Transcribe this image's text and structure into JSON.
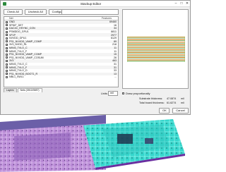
{
  "window": {
    "title": "Stackup Editor"
  },
  "toolbar": {
    "check_all": "Check All",
    "uncheck_all": "Uncheck All",
    "configure_nets": "Configure Nets"
  },
  "search": {
    "value": ""
  },
  "table": {
    "headers": [
      "Net",
      "Features"
    ],
    "rows": [
      {
        "name": "GND",
        "value": "69460",
        "checked": true
      },
      {
        "name": "SPDIF_DET",
        "value": "16",
        "checked": true
      },
      {
        "name": "DAC4C_HSYNC_CON",
        "value": "34",
        "checked": true
      },
      {
        "name": "PSMDDG_GPU1",
        "value": "8811",
        "checked": true
      },
      {
        "name": "VF1P",
        "value": "2977",
        "checked": true
      },
      {
        "name": "NVVDD_GPU1",
        "value": "6129",
        "checked": true
      },
      {
        "name": "PS1_NVVDD_VAMP_COMP",
        "value": "89",
        "checked": true
      },
      {
        "name": "3V3_NVDD_RL",
        "value": "218",
        "checked": true
      },
      {
        "name": "MINI3_TVLO_C",
        "value": "11",
        "checked": true
      },
      {
        "name": "MINI3_TVLO_F",
        "value": "11",
        "checked": true
      },
      {
        "name": "PS1_NVVDD_VAMP_COMP",
        "value": "15",
        "checked": true
      },
      {
        "name": "PS1_NVVDD_VAMP_COSUM",
        "value": "26",
        "checked": true
      },
      {
        "name": "3V3",
        "value": "463",
        "checked": true
      },
      {
        "name": "MINI3_TVLO_C",
        "value": "31",
        "checked": true
      },
      {
        "name": "MINI3_TVLO_F",
        "value": "31",
        "checked": true
      },
      {
        "name": "MINI3_TVLO_D",
        "value": "33",
        "checked": true
      },
      {
        "name": "PS1_NVVDD_BOOT1_R",
        "value": "13",
        "checked": true
      },
      {
        "name": "NBL1_SWL1",
        "value": "...",
        "checked": false
      }
    ]
  },
  "tabs": [
    "Layers",
    "Nets (3910/3987)"
  ],
  "units": {
    "label": "Units:",
    "value": "mil"
  },
  "options": {
    "draw_proportionally": "Draw proportionally"
  },
  "summary": {
    "substrate_label": "Substrate thickness:",
    "substrate_value": "47.0874",
    "substrate_unit": "mil",
    "total_label": "Total board thickness:",
    "total_value": "61.6274",
    "total_unit": "mil"
  },
  "buttons": {
    "ok": "OK",
    "cancel": "Cancel"
  },
  "colors": {
    "copper": "#d98a2f",
    "substrate": "#3f8f2e",
    "solder_mask": "#7fbf48",
    "pcb_purple": "#c59ae0",
    "pcb_cyan": "#3fe0d6"
  },
  "icons": {
    "app": "app-icon",
    "minimize": "minimize-icon",
    "maximize": "maximize-icon",
    "close": "close-icon"
  }
}
